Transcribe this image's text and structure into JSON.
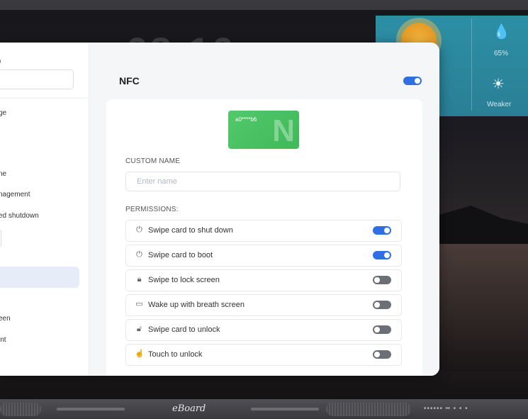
{
  "background": {
    "clock_fragment": "08:16",
    "weather": {
      "humidity": "65%",
      "uv_label": "Weaker"
    }
  },
  "sidebar": {
    "title": "p",
    "items": [
      {
        "label": "ge",
        "active": false
      },
      {
        "label": "ne",
        "active": false
      },
      {
        "label": "nagement",
        "active": false
      },
      {
        "label": "ed shutdown",
        "active": false
      },
      {
        "label": "",
        "active": true
      },
      {
        "label": "een",
        "active": false
      },
      {
        "label": "int",
        "active": false
      }
    ]
  },
  "panel": {
    "title": "NFC",
    "nfc_enabled": true,
    "card_id": "a0****b6",
    "custom_name_label": "CUSTOM NAME",
    "name_placeholder": "Enter name",
    "permissions_label": "PERMISSIONS:",
    "permissions": [
      {
        "icon": "power-icon",
        "label": "Swipe card to shut down",
        "enabled": true
      },
      {
        "icon": "power-icon",
        "label": "Swipe card to boot",
        "enabled": true
      },
      {
        "icon": "lock-icon",
        "label": "Swipe to lock screen",
        "enabled": false
      },
      {
        "icon": "screen-icon",
        "label": "Wake up with breath screen",
        "enabled": false
      },
      {
        "icon": "unlock-icon",
        "label": "Swipe card to unlock",
        "enabled": false
      },
      {
        "icon": "touch-icon",
        "label": "Touch to unlock",
        "enabled": false
      }
    ]
  },
  "bezel": {
    "brand": "eBoard"
  },
  "colors": {
    "accent": "#2f6fe4",
    "toggle_off": "#6c6f75",
    "nfc_card": "#4cc465"
  }
}
